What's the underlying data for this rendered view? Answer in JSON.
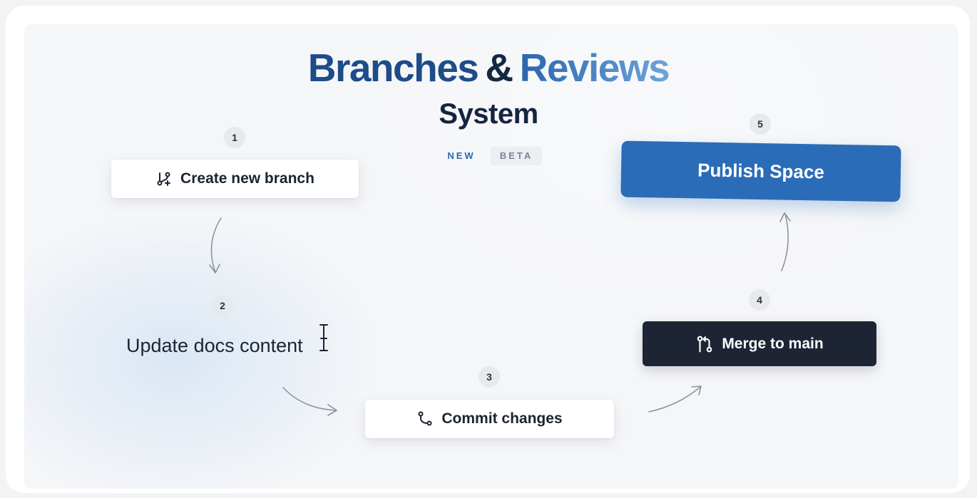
{
  "title": {
    "part1": "Branches",
    "amp": "&",
    "part2": "Reviews"
  },
  "subtitle": "System",
  "badges": {
    "new": "NEW",
    "beta": "BETA"
  },
  "steps": [
    {
      "number": "1",
      "label": "Create new branch",
      "icon": "git-branch-plus-icon"
    },
    {
      "number": "2",
      "label": "Update docs content",
      "icon": "text-cursor-icon"
    },
    {
      "number": "3",
      "label": "Commit changes",
      "icon": "git-commit-icon"
    },
    {
      "number": "4",
      "label": "Merge to main",
      "icon": "git-merge-icon"
    },
    {
      "number": "5",
      "label": "Publish Space"
    }
  ],
  "colors": {
    "title_dark_blue": "#1e4c8a",
    "title_gradient_start": "#2b66ae",
    "title_gradient_end": "#6fa4da",
    "publish_blue": "#2a6cb7",
    "merge_dark": "#1d2535"
  }
}
